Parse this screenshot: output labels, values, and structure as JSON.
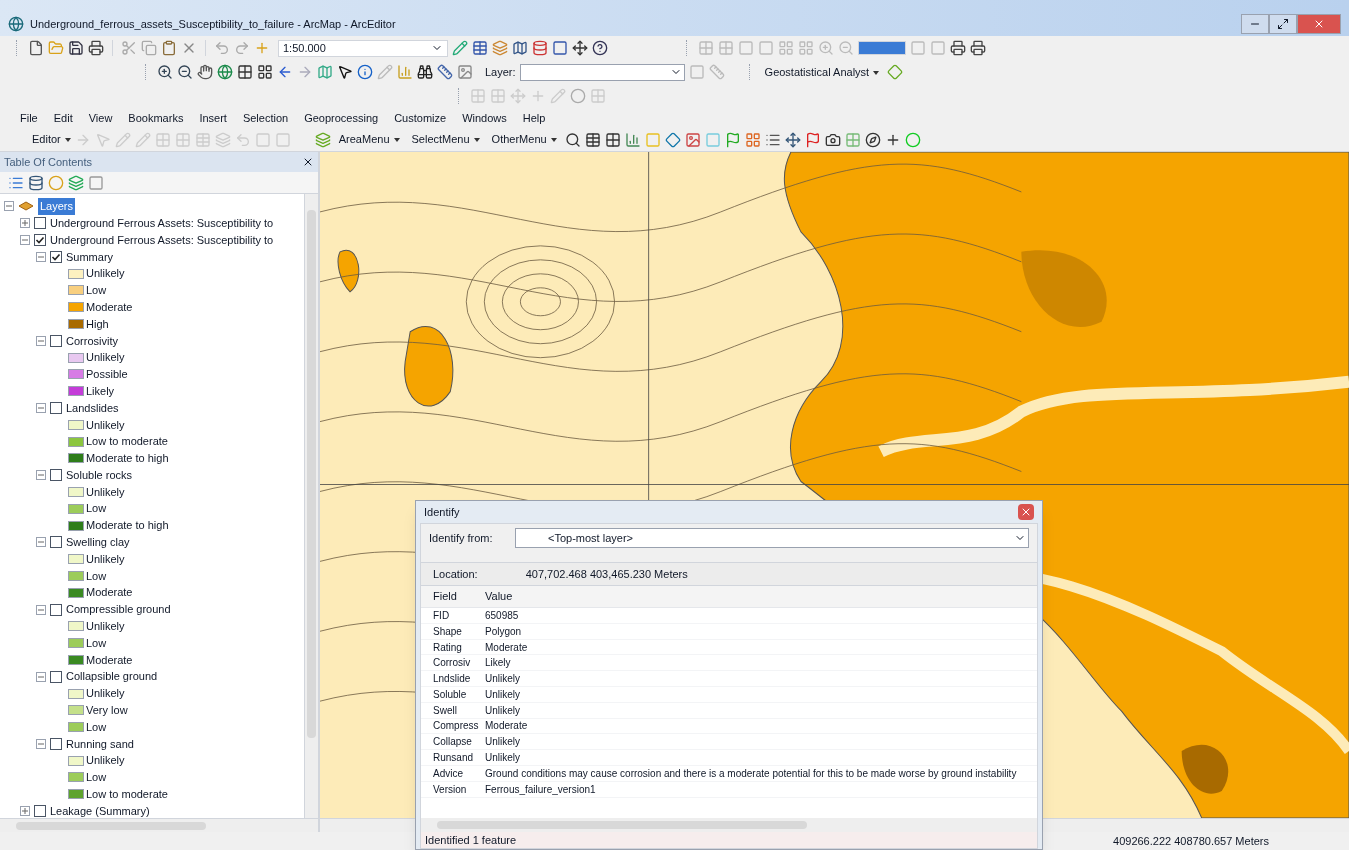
{
  "window": {
    "title": "Underground_ferrous_assets_Susceptibility_to_failure - ArcMap - ArcEditor"
  },
  "toolbar": {
    "scale": "1:50.000",
    "layer_label": "Layer:",
    "analyst_menu": "Geostatistical Analyst"
  },
  "menu": [
    "File",
    "Edit",
    "View",
    "Bookmarks",
    "Insert",
    "Selection",
    "Geoprocessing",
    "Customize",
    "Windows",
    "Help"
  ],
  "editor_toolbar": {
    "editor_menu": "Editor",
    "menus": [
      "AreaMenu",
      "SelectMenu",
      "OtherMenu"
    ]
  },
  "toc": {
    "title": "Table Of Contents",
    "tree": [
      {
        "kind": "frame",
        "label": "Layers",
        "selected": true,
        "expanded": true,
        "children": [
          {
            "kind": "layer",
            "label": "Underground Ferrous Assets: Susceptibility to",
            "checked": false,
            "expanded": false
          },
          {
            "kind": "layer",
            "label": "Underground Ferrous Assets: Susceptibility to",
            "checked": true,
            "expanded": true,
            "children": [
              {
                "kind": "layer",
                "label": "Summary",
                "checked": true,
                "expanded": true,
                "children": [
                  {
                    "kind": "class",
                    "label": "Unlikely",
                    "color": "#fdf1c0"
                  },
                  {
                    "kind": "class",
                    "label": "Low",
                    "color": "#f8cf7f"
                  },
                  {
                    "kind": "class",
                    "label": "Moderate",
                    "color": "#f5a400"
                  },
                  {
                    "kind": "class",
                    "label": "High",
                    "color": "#a86a00"
                  }
                ]
              },
              {
                "kind": "layer",
                "label": "Corrosivity",
                "checked": false,
                "expanded": true,
                "children": [
                  {
                    "kind": "class",
                    "label": "Unlikely",
                    "color": "#e8c8f0"
                  },
                  {
                    "kind": "class",
                    "label": "Possible",
                    "color": "#d77be5"
                  },
                  {
                    "kind": "class",
                    "label": "Likely",
                    "color": "#c43cd8"
                  }
                ]
              },
              {
                "kind": "layer",
                "label": "Landslides",
                "checked": false,
                "expanded": true,
                "children": [
                  {
                    "kind": "class",
                    "label": "Unlikely",
                    "color": "#f0f7c8"
                  },
                  {
                    "kind": "class",
                    "label": "Low to moderate",
                    "color": "#8cc63f"
                  },
                  {
                    "kind": "class",
                    "label": "Moderate to high",
                    "color": "#2e7d1a"
                  }
                ]
              },
              {
                "kind": "layer",
                "label": "Soluble rocks",
                "checked": false,
                "expanded": true,
                "children": [
                  {
                    "kind": "class",
                    "label": "Unlikely",
                    "color": "#f0f7c8"
                  },
                  {
                    "kind": "class",
                    "label": "Low",
                    "color": "#9ccc5a"
                  },
                  {
                    "kind": "class",
                    "label": "Moderate to high",
                    "color": "#2e7d1a"
                  }
                ]
              },
              {
                "kind": "layer",
                "label": "Swelling clay",
                "checked": false,
                "expanded": true,
                "children": [
                  {
                    "kind": "class",
                    "label": "Unlikely",
                    "color": "#f0f7c8"
                  },
                  {
                    "kind": "class",
                    "label": "Low",
                    "color": "#9ccc5a"
                  },
                  {
                    "kind": "class",
                    "label": "Moderate",
                    "color": "#3a8a22"
                  }
                ]
              },
              {
                "kind": "layer",
                "label": "Compressible ground",
                "checked": false,
                "expanded": true,
                "children": [
                  {
                    "kind": "class",
                    "label": "Unlikely",
                    "color": "#f0f7c8"
                  },
                  {
                    "kind": "class",
                    "label": "Low",
                    "color": "#9ccc5a"
                  },
                  {
                    "kind": "class",
                    "label": "Moderate",
                    "color": "#3a8a22"
                  }
                ]
              },
              {
                "kind": "layer",
                "label": "Collapsible ground",
                "checked": false,
                "expanded": true,
                "children": [
                  {
                    "kind": "class",
                    "label": "Unlikely",
                    "color": "#f0f7c8"
                  },
                  {
                    "kind": "class",
                    "label": "Very low",
                    "color": "#c4e08a"
                  },
                  {
                    "kind": "class",
                    "label": "Low",
                    "color": "#9ccc5a"
                  }
                ]
              },
              {
                "kind": "layer",
                "label": "Running sand",
                "checked": false,
                "expanded": true,
                "children": [
                  {
                    "kind": "class",
                    "label": "Unlikely",
                    "color": "#f0f7c8"
                  },
                  {
                    "kind": "class",
                    "label": "Low",
                    "color": "#9ccc5a"
                  },
                  {
                    "kind": "class",
                    "label": "Low to moderate",
                    "color": "#5ea32e"
                  }
                ]
              }
            ]
          },
          {
            "kind": "layer",
            "label": "Leakage (Summary)",
            "checked": false,
            "expanded": false
          }
        ]
      }
    ]
  },
  "identify": {
    "title": "Identify",
    "from_label": "Identify from:",
    "from_value": "<Top-most layer>",
    "location_label": "Location:",
    "location_value": "407,702.468  403,465.230 Meters",
    "columns": [
      "Field",
      "Value"
    ],
    "rows": [
      [
        "FID",
        "650985"
      ],
      [
        "Shape",
        "Polygon"
      ],
      [
        "Rating",
        "Moderate"
      ],
      [
        "Corrosiv",
        "Likely"
      ],
      [
        "Lndslide",
        "Unlikely"
      ],
      [
        "Soluble",
        "Unlikely"
      ],
      [
        "Swell",
        "Unlikely"
      ],
      [
        "Compress",
        "Moderate"
      ],
      [
        "Collapse",
        "Unlikely"
      ],
      [
        "Runsand",
        "Unlikely"
      ],
      [
        "Advice",
        "Ground conditions may cause corrosion and there is a moderate potential for this to be made worse by ground instability"
      ],
      [
        "Version",
        "Ferrous_failure_version1"
      ]
    ],
    "status": "Identified 1 feature"
  },
  "status_bar": {
    "coordinates": "409266.222  408780.657 Meters"
  }
}
